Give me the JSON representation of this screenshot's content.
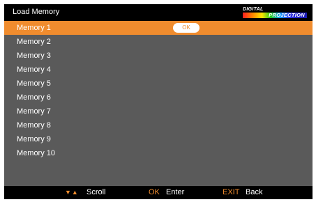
{
  "header": {
    "title": "Load Memory",
    "logo_top": "DIGITAL",
    "logo_bottom": "PROJECTION"
  },
  "list": {
    "items": [
      {
        "label": "Memory 1",
        "selected": true
      },
      {
        "label": "Memory 2",
        "selected": false
      },
      {
        "label": "Memory 3",
        "selected": false
      },
      {
        "label": "Memory 4",
        "selected": false
      },
      {
        "label": "Memory 5",
        "selected": false
      },
      {
        "label": "Memory 6",
        "selected": false
      },
      {
        "label": "Memory 7",
        "selected": false
      },
      {
        "label": "Memory 8",
        "selected": false
      },
      {
        "label": "Memory 9",
        "selected": false
      },
      {
        "label": "Memory 10",
        "selected": false
      }
    ],
    "ok_button": "OK"
  },
  "footer": {
    "scroll_icon": "▼▲",
    "scroll_label": "Scroll",
    "ok_key": "OK",
    "ok_label": "Enter",
    "exit_key": "EXIT",
    "exit_label": "Back"
  },
  "colors": {
    "accent": "#f08c2e",
    "list_background": "#5a5a5a",
    "bar_background": "#000000",
    "text": "#ffffff"
  }
}
